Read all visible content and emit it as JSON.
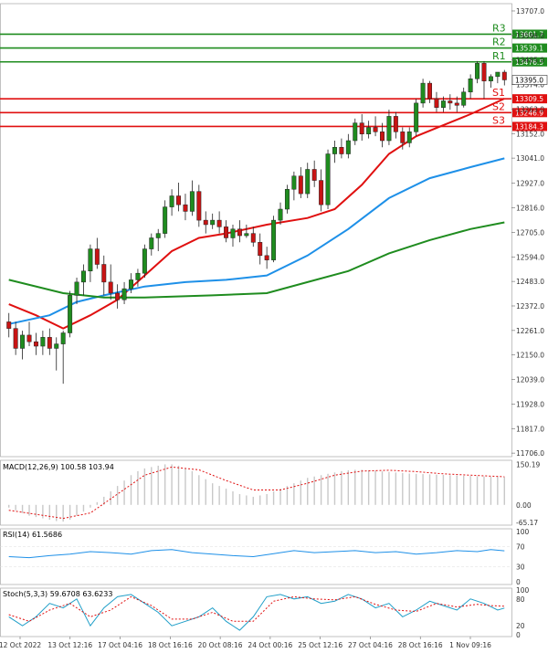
{
  "chart_data": {
    "type": "candlestick",
    "price_axis": {
      "ticks": [
        13707.0,
        13596.0,
        13485.0,
        13374.0,
        13263.0,
        13152.0,
        13041.0,
        12927.0,
        12816.0,
        12705.0,
        12594.0,
        12483.0,
        12372.0,
        12261.0,
        12150.0,
        12039.0,
        11928.0,
        11817.0,
        11706.0
      ],
      "range": [
        11690,
        13740
      ]
    },
    "time_axis": {
      "labels": [
        "12 Oct 2022",
        "13 Oct 12:16",
        "17 Oct 04:16",
        "18 Oct 16:16",
        "20 Oct 08:16",
        "24 Oct 00:16",
        "25 Oct 12:16",
        "27 Oct 04:16",
        "28 Oct 16:16",
        "1 Nov 09:16"
      ]
    },
    "levels": [
      {
        "name": "R3",
        "value": "13601.7",
        "color": "#1f8c1f"
      },
      {
        "name": "R2",
        "value": "13539.1",
        "color": "#1f8c1f"
      },
      {
        "name": "R1",
        "value": "13476.5",
        "color": "#1f8c1f"
      },
      {
        "name": "S1",
        "value": "13309.5",
        "color": "#e01010"
      },
      {
        "name": "S2",
        "value": "13246.9",
        "color": "#e01010"
      },
      {
        "name": "S3",
        "value": "13184.3",
        "color": "#e01010"
      }
    ],
    "current_price": "13395.0",
    "candles": [
      {
        "o": 12300,
        "h": 12340,
        "l": 12230,
        "c": 12270
      },
      {
        "o": 12270,
        "h": 12300,
        "l": 12150,
        "c": 12180
      },
      {
        "o": 12180,
        "h": 12260,
        "l": 12130,
        "c": 12240
      },
      {
        "o": 12240,
        "h": 12300,
        "l": 12190,
        "c": 12210
      },
      {
        "o": 12210,
        "h": 12250,
        "l": 12150,
        "c": 12190
      },
      {
        "o": 12190,
        "h": 12260,
        "l": 12150,
        "c": 12230
      },
      {
        "o": 12230,
        "h": 12270,
        "l": 12150,
        "c": 12180
      },
      {
        "o": 12180,
        "h": 12230,
        "l": 12080,
        "c": 12200
      },
      {
        "o": 12200,
        "h": 12260,
        "l": 12020,
        "c": 12250
      },
      {
        "o": 12250,
        "h": 12440,
        "l": 12230,
        "c": 12420
      },
      {
        "o": 12420,
        "h": 12500,
        "l": 12380,
        "c": 12480
      },
      {
        "o": 12480,
        "h": 12560,
        "l": 12420,
        "c": 12530
      },
      {
        "o": 12530,
        "h": 12650,
        "l": 12480,
        "c": 12630
      },
      {
        "o": 12630,
        "h": 12680,
        "l": 12540,
        "c": 12560
      },
      {
        "o": 12560,
        "h": 12600,
        "l": 12420,
        "c": 12480
      },
      {
        "o": 12480,
        "h": 12560,
        "l": 12400,
        "c": 12430
      },
      {
        "o": 12430,
        "h": 12470,
        "l": 12360,
        "c": 12400
      },
      {
        "o": 12400,
        "h": 12480,
        "l": 12380,
        "c": 12450
      },
      {
        "o": 12450,
        "h": 12520,
        "l": 12430,
        "c": 12490
      },
      {
        "o": 12490,
        "h": 12540,
        "l": 12460,
        "c": 12520
      },
      {
        "o": 12520,
        "h": 12650,
        "l": 12500,
        "c": 12630
      },
      {
        "o": 12630,
        "h": 12700,
        "l": 12600,
        "c": 12680
      },
      {
        "o": 12680,
        "h": 12720,
        "l": 12620,
        "c": 12700
      },
      {
        "o": 12700,
        "h": 12850,
        "l": 12680,
        "c": 12820
      },
      {
        "o": 12820,
        "h": 12900,
        "l": 12780,
        "c": 12870
      },
      {
        "o": 12870,
        "h": 12930,
        "l": 12800,
        "c": 12830
      },
      {
        "o": 12830,
        "h": 12880,
        "l": 12760,
        "c": 12800
      },
      {
        "o": 12800,
        "h": 12940,
        "l": 12780,
        "c": 12890
      },
      {
        "o": 12890,
        "h": 12920,
        "l": 12730,
        "c": 12760
      },
      {
        "o": 12760,
        "h": 12800,
        "l": 12700,
        "c": 12740
      },
      {
        "o": 12740,
        "h": 12790,
        "l": 12720,
        "c": 12760
      },
      {
        "o": 12760,
        "h": 12800,
        "l": 12700,
        "c": 12730
      },
      {
        "o": 12730,
        "h": 12760,
        "l": 12660,
        "c": 12680
      },
      {
        "o": 12680,
        "h": 12740,
        "l": 12640,
        "c": 12720
      },
      {
        "o": 12720,
        "h": 12760,
        "l": 12660,
        "c": 12690
      },
      {
        "o": 12690,
        "h": 12740,
        "l": 12680,
        "c": 12700
      },
      {
        "o": 12700,
        "h": 12730,
        "l": 12640,
        "c": 12660
      },
      {
        "o": 12660,
        "h": 12700,
        "l": 12560,
        "c": 12600
      },
      {
        "o": 12600,
        "h": 12640,
        "l": 12540,
        "c": 12580
      },
      {
        "o": 12580,
        "h": 12780,
        "l": 12570,
        "c": 12760
      },
      {
        "o": 12760,
        "h": 12840,
        "l": 12740,
        "c": 12810
      },
      {
        "o": 12810,
        "h": 12920,
        "l": 12790,
        "c": 12900
      },
      {
        "o": 12900,
        "h": 12980,
        "l": 12850,
        "c": 12960
      },
      {
        "o": 12960,
        "h": 13000,
        "l": 12860,
        "c": 12880
      },
      {
        "o": 12880,
        "h": 13020,
        "l": 12860,
        "c": 12990
      },
      {
        "o": 12990,
        "h": 13030,
        "l": 12910,
        "c": 12940
      },
      {
        "o": 12940,
        "h": 12990,
        "l": 12800,
        "c": 12830
      },
      {
        "o": 12830,
        "h": 13080,
        "l": 12810,
        "c": 13060
      },
      {
        "o": 13060,
        "h": 13120,
        "l": 13020,
        "c": 13090
      },
      {
        "o": 13090,
        "h": 13130,
        "l": 13040,
        "c": 13060
      },
      {
        "o": 13060,
        "h": 13150,
        "l": 13040,
        "c": 13120
      },
      {
        "o": 13120,
        "h": 13220,
        "l": 13100,
        "c": 13200
      },
      {
        "o": 13200,
        "h": 13240,
        "l": 13120,
        "c": 13150
      },
      {
        "o": 13150,
        "h": 13210,
        "l": 13130,
        "c": 13180
      },
      {
        "o": 13180,
        "h": 13230,
        "l": 13140,
        "c": 13160
      },
      {
        "o": 13160,
        "h": 13200,
        "l": 13090,
        "c": 13120
      },
      {
        "o": 13120,
        "h": 13260,
        "l": 13100,
        "c": 13230
      },
      {
        "o": 13230,
        "h": 13250,
        "l": 13130,
        "c": 13160
      },
      {
        "o": 13160,
        "h": 13180,
        "l": 13080,
        "c": 13110
      },
      {
        "o": 13110,
        "h": 13180,
        "l": 13090,
        "c": 13160
      },
      {
        "o": 13160,
        "h": 13310,
        "l": 13140,
        "c": 13290
      },
      {
        "o": 13290,
        "h": 13400,
        "l": 13270,
        "c": 13380
      },
      {
        "o": 13380,
        "h": 13390,
        "l": 13290,
        "c": 13310
      },
      {
        "o": 13310,
        "h": 13340,
        "l": 13250,
        "c": 13270
      },
      {
        "o": 13270,
        "h": 13320,
        "l": 13250,
        "c": 13300
      },
      {
        "o": 13300,
        "h": 13330,
        "l": 13260,
        "c": 13290
      },
      {
        "o": 13290,
        "h": 13320,
        "l": 13250,
        "c": 13280
      },
      {
        "o": 13280,
        "h": 13360,
        "l": 13270,
        "c": 13340
      },
      {
        "o": 13340,
        "h": 13420,
        "l": 13310,
        "c": 13400
      },
      {
        "o": 13400,
        "h": 13480,
        "l": 13380,
        "c": 13470
      },
      {
        "o": 13470,
        "h": 13480,
        "l": 13310,
        "c": 13390
      },
      {
        "o": 13390,
        "h": 13420,
        "l": 13360,
        "c": 13410
      },
      {
        "o": 13410,
        "h": 13430,
        "l": 13380,
        "c": 13430
      },
      {
        "o": 13430,
        "h": 13440,
        "l": 13370,
        "c": 13395
      }
    ],
    "moving_averages": [
      {
        "color": "#e01010",
        "values": [
          [
            0,
            12380
          ],
          [
            4,
            12330
          ],
          [
            8,
            12270
          ],
          [
            12,
            12330
          ],
          [
            16,
            12400
          ],
          [
            20,
            12510
          ],
          [
            24,
            12620
          ],
          [
            28,
            12680
          ],
          [
            32,
            12700
          ],
          [
            38,
            12740
          ],
          [
            44,
            12770
          ],
          [
            48,
            12810
          ],
          [
            52,
            12920
          ],
          [
            56,
            13060
          ],
          [
            60,
            13140
          ],
          [
            64,
            13190
          ],
          [
            68,
            13240
          ],
          [
            73,
            13310
          ]
        ]
      },
      {
        "color": "#1e90e8",
        "values": [
          [
            0,
            12290
          ],
          [
            6,
            12330
          ],
          [
            10,
            12390
          ],
          [
            14,
            12420
          ],
          [
            20,
            12460
          ],
          [
            26,
            12480
          ],
          [
            32,
            12490
          ],
          [
            38,
            12510
          ],
          [
            44,
            12600
          ],
          [
            50,
            12720
          ],
          [
            56,
            12860
          ],
          [
            62,
            12950
          ],
          [
            68,
            13000
          ],
          [
            73,
            13040
          ]
        ]
      },
      {
        "color": "#1f8c1f",
        "values": [
          [
            0,
            12490
          ],
          [
            8,
            12430
          ],
          [
            14,
            12410
          ],
          [
            20,
            12410
          ],
          [
            30,
            12420
          ],
          [
            38,
            12430
          ],
          [
            44,
            12480
          ],
          [
            50,
            12530
          ],
          [
            56,
            12610
          ],
          [
            62,
            12670
          ],
          [
            68,
            12720
          ],
          [
            73,
            12750
          ]
        ]
      }
    ],
    "macd": {
      "label": "MACD(12,26,9) 100.58 103.94",
      "ticks": [
        "150.19",
        "0.00",
        "-65.17"
      ],
      "range": [
        -75,
        165
      ],
      "hist": [
        -10,
        -20,
        -30,
        -40,
        -45,
        -50,
        -55,
        -60,
        -62,
        -55,
        -40,
        -25,
        -10,
        10,
        30,
        50,
        70,
        90,
        110,
        125,
        135,
        140,
        145,
        150,
        150,
        145,
        135,
        125,
        110,
        95,
        80,
        70,
        60,
        50,
        40,
        35,
        30,
        35,
        40,
        50,
        60,
        70,
        80,
        90,
        100,
        105,
        110,
        115,
        120,
        125,
        128,
        130,
        130,
        128,
        126,
        124,
        122,
        120,
        118,
        116,
        115,
        114,
        113,
        112,
        111,
        110,
        109,
        108,
        107,
        106,
        105,
        104,
        104,
        103
      ],
      "signal": [
        [
          0,
          -20
        ],
        [
          8,
          -50
        ],
        [
          12,
          -30
        ],
        [
          16,
          40
        ],
        [
          20,
          110
        ],
        [
          24,
          140
        ],
        [
          28,
          130
        ],
        [
          32,
          90
        ],
        [
          36,
          55
        ],
        [
          40,
          55
        ],
        [
          44,
          80
        ],
        [
          48,
          110
        ],
        [
          52,
          125
        ],
        [
          56,
          128
        ],
        [
          60,
          123
        ],
        [
          64,
          115
        ],
        [
          68,
          110
        ],
        [
          73,
          104
        ]
      ]
    },
    "rsi": {
      "label": "RSI(14) 61.5686",
      "ticks": [
        "100",
        "70",
        "30",
        "0"
      ],
      "range": [
        0,
        100
      ],
      "line": [
        [
          0,
          50
        ],
        [
          3,
          48
        ],
        [
          6,
          52
        ],
        [
          9,
          55
        ],
        [
          12,
          60
        ],
        [
          15,
          58
        ],
        [
          18,
          55
        ],
        [
          21,
          62
        ],
        [
          24,
          64
        ],
        [
          27,
          58
        ],
        [
          30,
          55
        ],
        [
          33,
          52
        ],
        [
          36,
          50
        ],
        [
          39,
          56
        ],
        [
          42,
          62
        ],
        [
          45,
          58
        ],
        [
          48,
          60
        ],
        [
          51,
          62
        ],
        [
          54,
          58
        ],
        [
          57,
          60
        ],
        [
          60,
          55
        ],
        [
          63,
          58
        ],
        [
          66,
          62
        ],
        [
          69,
          60
        ],
        [
          71,
          64
        ],
        [
          73,
          61.57
        ]
      ]
    },
    "stoch": {
      "label": "Stoch(5,3,3) 59.6708 63.6233",
      "ticks": [
        "100",
        "80",
        "20",
        "0"
      ],
      "range": [
        0,
        100
      ],
      "k": [
        [
          0,
          40
        ],
        [
          2,
          20
        ],
        [
          4,
          40
        ],
        [
          6,
          70
        ],
        [
          8,
          60
        ],
        [
          10,
          80
        ],
        [
          12,
          20
        ],
        [
          14,
          60
        ],
        [
          16,
          85
        ],
        [
          18,
          90
        ],
        [
          20,
          70
        ],
        [
          22,
          50
        ],
        [
          24,
          20
        ],
        [
          26,
          30
        ],
        [
          28,
          40
        ],
        [
          30,
          60
        ],
        [
          32,
          30
        ],
        [
          34,
          10
        ],
        [
          36,
          40
        ],
        [
          38,
          85
        ],
        [
          40,
          90
        ],
        [
          42,
          80
        ],
        [
          44,
          85
        ],
        [
          46,
          70
        ],
        [
          48,
          75
        ],
        [
          50,
          90
        ],
        [
          52,
          80
        ],
        [
          54,
          60
        ],
        [
          56,
          70
        ],
        [
          58,
          40
        ],
        [
          60,
          55
        ],
        [
          62,
          75
        ],
        [
          64,
          65
        ],
        [
          66,
          55
        ],
        [
          68,
          80
        ],
        [
          70,
          70
        ],
        [
          72,
          55
        ],
        [
          73,
          59.67
        ]
      ],
      "d": [
        [
          0,
          45
        ],
        [
          3,
          30
        ],
        [
          6,
          55
        ],
        [
          9,
          70
        ],
        [
          12,
          40
        ],
        [
          15,
          55
        ],
        [
          18,
          85
        ],
        [
          21,
          65
        ],
        [
          24,
          35
        ],
        [
          27,
          35
        ],
        [
          30,
          50
        ],
        [
          33,
          30
        ],
        [
          36,
          30
        ],
        [
          39,
          75
        ],
        [
          42,
          85
        ],
        [
          45,
          80
        ],
        [
          48,
          78
        ],
        [
          51,
          85
        ],
        [
          54,
          68
        ],
        [
          57,
          55
        ],
        [
          60,
          52
        ],
        [
          63,
          70
        ],
        [
          66,
          62
        ],
        [
          69,
          68
        ],
        [
          71,
          65
        ],
        [
          73,
          63.62
        ]
      ]
    }
  }
}
